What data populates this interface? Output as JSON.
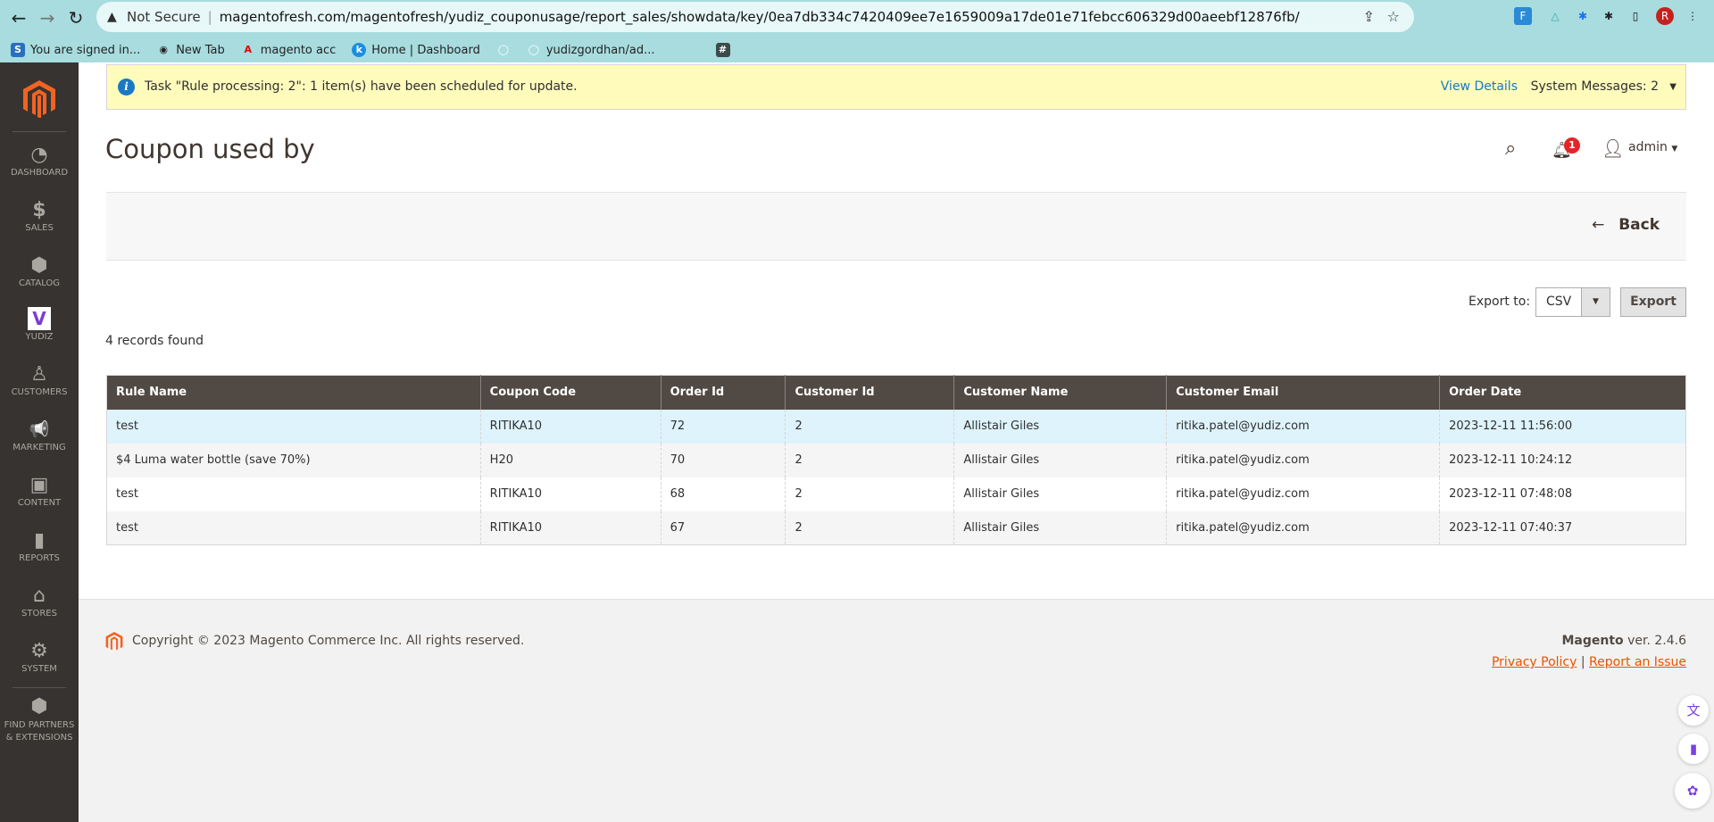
{
  "browser": {
    "security": "Not Secure",
    "url": "magentofresh.com/magentofresh/yudiz_couponusage/report_sales/showdata/key/0ea7db334c7420409ee7e1659009a17de01e71febcc606329d00aeebf12876fb/",
    "profile_initial": "R",
    "bookmarks": [
      {
        "label": "You are signed in...",
        "icon": "S"
      },
      {
        "label": "New Tab",
        "icon": "◉"
      },
      {
        "label": "magento acc",
        "icon": "A"
      },
      {
        "label": "Home | Dashboard",
        "icon": "k"
      },
      {
        "label": "",
        "icon": "◯"
      },
      {
        "label": "yudizgordhan/ad...",
        "icon": "◯"
      },
      {
        "label": "",
        "icon": "#"
      }
    ]
  },
  "sidebar": {
    "items": [
      {
        "label": "DASHBOARD",
        "icon": "◔"
      },
      {
        "label": "SALES",
        "icon": "$"
      },
      {
        "label": "CATALOG",
        "icon": "⬢"
      },
      {
        "label": "YUDIZ",
        "icon": "V"
      },
      {
        "label": "CUSTOMERS",
        "icon": "♙"
      },
      {
        "label": "MARKETING",
        "icon": "📢"
      },
      {
        "label": "CONTENT",
        "icon": "▣"
      },
      {
        "label": "REPORTS",
        "icon": "▮"
      },
      {
        "label": "STORES",
        "icon": "⌂"
      },
      {
        "label": "SYSTEM",
        "icon": "⚙"
      }
    ],
    "partners": "FIND PARTNERS & EXTENSIONS"
  },
  "message": {
    "text": "Task \"Rule processing: 2\": 1 item(s) have been scheduled for update.",
    "view_details": "View Details",
    "system_messages": "System Messages: 2"
  },
  "header": {
    "title": "Coupon used by",
    "notifications": "1",
    "user": "admin"
  },
  "actions": {
    "back": "Back"
  },
  "export": {
    "label": "Export to:",
    "format": "CSV",
    "button": "Export"
  },
  "grid": {
    "records": "4 records found",
    "columns": [
      "Rule Name",
      "Coupon Code",
      "Order Id",
      "Customer Id",
      "Customer Name",
      "Customer Email",
      "Order Date"
    ],
    "rows": [
      [
        "test",
        "RITIKA10",
        "72",
        "2",
        "Allistair Giles",
        "ritika.patel@yudiz.com",
        "2023-12-11 11:56:00"
      ],
      [
        "$4 Luma water bottle (save 70%)",
        "H20",
        "70",
        "2",
        "Allistair Giles",
        "ritika.patel@yudiz.com",
        "2023-12-11 10:24:12"
      ],
      [
        "test",
        "RITIKA10",
        "68",
        "2",
        "Allistair Giles",
        "ritika.patel@yudiz.com",
        "2023-12-11 07:48:08"
      ],
      [
        "test",
        "RITIKA10",
        "67",
        "2",
        "Allistair Giles",
        "ritika.patel@yudiz.com",
        "2023-12-11 07:40:37"
      ]
    ]
  },
  "footer": {
    "copyright": "Copyright © 2023 Magento Commerce Inc. All rights reserved.",
    "brand": "Magento",
    "version": " ver. 2.4.6",
    "privacy": "Privacy Policy",
    "separator": "|",
    "report": "Report an Issue"
  },
  "colors": {
    "accent": "#eb5202",
    "sidebar": "#373330",
    "grid_header": "#514943",
    "message_bg": "#fffbbb",
    "link": "#1979c3"
  }
}
